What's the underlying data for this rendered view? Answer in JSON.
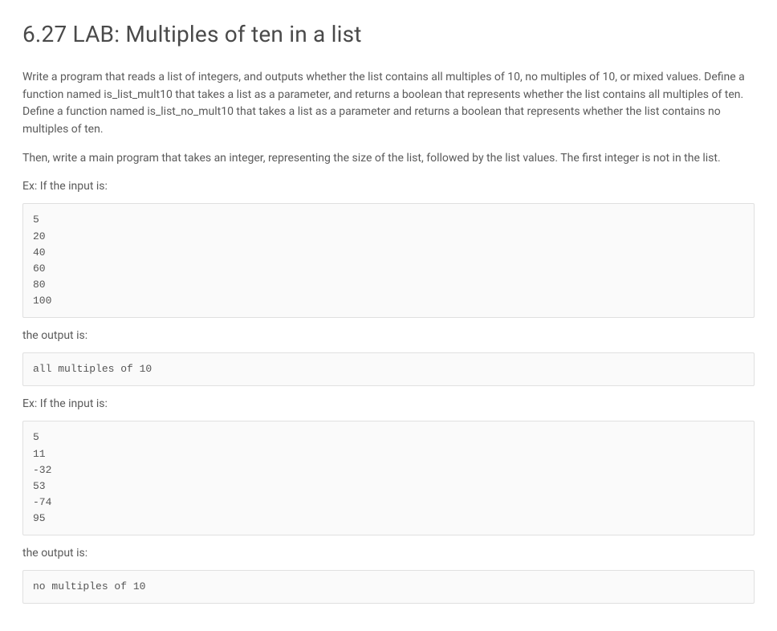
{
  "title": "6.27 LAB: Multiples of ten in a list",
  "paragraphs": {
    "intro": "Write a program that reads a list of integers, and outputs whether the list contains all multiples of 10, no multiples of 10, or mixed values. Define a function named is_list_mult10 that takes a list as a parameter, and returns a boolean that represents whether the list contains all multiples of ten. Define a function named is_list_no_mult10 that takes a list as a parameter and returns a boolean that represents whether the list contains no multiples of ten.",
    "main_program": "Then, write a main program that takes an integer, representing the size of the list, followed by the list values. The first integer is not in the list."
  },
  "labels": {
    "ex_input_1": "Ex: If the input is:",
    "output_1": "the output is:",
    "ex_input_2": "Ex: If the input is:",
    "output_2": "the output is:"
  },
  "code": {
    "input_1": "5\n20\n40\n60\n80\n100",
    "output_1": "all multiples of 10",
    "input_2": "5\n11\n-32\n53\n-74\n95",
    "output_2": "no multiples of 10"
  }
}
